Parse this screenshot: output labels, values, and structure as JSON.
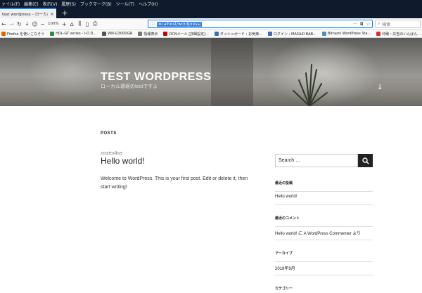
{
  "menubar": {
    "items": [
      "ァイル(F)",
      "編集(E)",
      "表示(V)",
      "履歴(S)",
      "ブックマーク(B)",
      "ツール(T)",
      "ヘルプ(H)"
    ]
  },
  "tab": {
    "title": "test wordpress – ローカル環境のtest",
    "close_label": "×",
    "new_tab_label": "+"
  },
  "navbar": {
    "zoom": "100%",
    "url": "localhost/wordpress/",
    "url_icon": "info-icon",
    "search_placeholder": "検索"
  },
  "bookmarks": [
    {
      "label": "Firefox を使いこなそう",
      "color": "#e66000"
    },
    {
      "label": "HDL-GT series - I-O D...",
      "color": "#2a8f3a"
    },
    {
      "label": "WN-G300DGR",
      "color": "#555555"
    },
    {
      "label": "情報表示",
      "color": "#777777"
    },
    {
      "label": "OCNメール [詳細設定]...",
      "color": "#cc0000"
    },
    {
      "label": "ダッシュボード ‹ お気楽...",
      "color": "#3a6fb0"
    },
    {
      "label": "ログイン ‹ MASAKI BAB...",
      "color": "#3a6fb0"
    },
    {
      "label": "Bitnami WordPress Sta...",
      "color": "#4a90c0"
    },
    {
      "label": "印刷・広告のいんばん...",
      "color": "#d23030"
    },
    {
      "label": "Twitter / ホーム",
      "color": "#1da1f2"
    }
  ],
  "site": {
    "title": "TEST WORDPRESS",
    "description": "ローカル環境のtestですよ",
    "scroll_icon": "arrow-down-icon"
  },
  "main": {
    "posts_heading": "POSTS",
    "post": {
      "date": "2018年9月6日",
      "title": "Hello world!",
      "body": "Welcome to WordPress. This is your first post. Edit or delete it, then start writing!"
    }
  },
  "sidebar": {
    "search_placeholder": "Search …",
    "recent_posts_heading": "最近の投稿",
    "recent_post": "Hello world!",
    "recent_comments_heading": "最近のコメント",
    "recent_comment": "Hello world! に A WordPress Commenter より",
    "archives_heading": "アーカイブ",
    "archive_item": "2018年9月",
    "categories_heading": "カテゴリー"
  }
}
